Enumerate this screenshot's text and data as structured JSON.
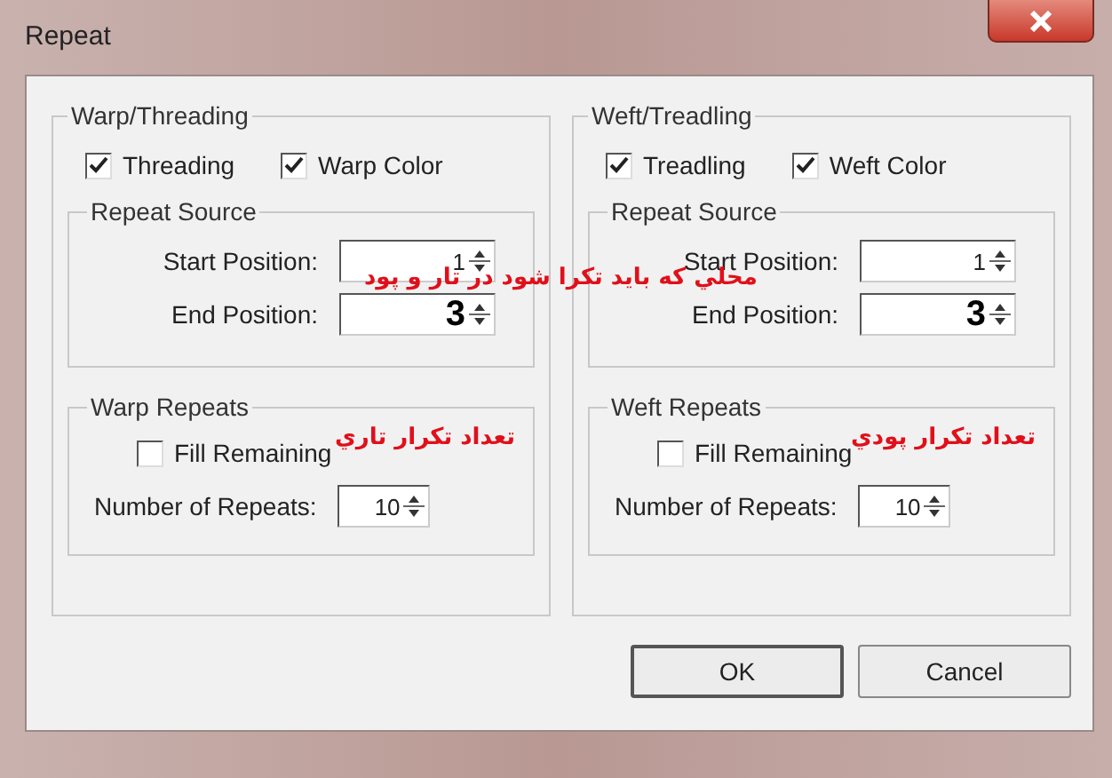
{
  "window": {
    "title": "Repeat"
  },
  "groups": [
    {
      "title": "Warp/Threading",
      "checkboxes": [
        {
          "label": "Threading",
          "checked": true
        },
        {
          "label": "Warp Color",
          "checked": true
        }
      ],
      "source": {
        "title": "Repeat Source",
        "fields": [
          {
            "label": "Start Position:",
            "value": "1",
            "bold": false
          },
          {
            "label": "End Position:",
            "value": "3",
            "bold": true
          }
        ]
      },
      "repeats": {
        "title": "Warp Repeats",
        "fill": {
          "label": "Fill Remaining",
          "checked": false
        },
        "count": {
          "label": "Number of Repeats:",
          "value": "10"
        },
        "note": "تعداد تكرار تاري"
      }
    },
    {
      "title": "Weft/Treadling",
      "checkboxes": [
        {
          "label": "Treadling",
          "checked": true
        },
        {
          "label": "Weft Color",
          "checked": true
        }
      ],
      "source": {
        "title": "Repeat Source",
        "fields": [
          {
            "label": "Start Position:",
            "value": "1",
            "bold": false
          },
          {
            "label": "End Position:",
            "value": "3",
            "bold": true
          }
        ]
      },
      "repeats": {
        "title": "Weft Repeats",
        "fill": {
          "label": "Fill Remaining",
          "checked": false
        },
        "count": {
          "label": "Number of Repeats:",
          "value": "10"
        },
        "note": "تعداد تكرار پودي"
      }
    }
  ],
  "source_note": "محلي كه بايد تكرا شود در تار و پود",
  "buttons": [
    {
      "label": "OK",
      "default": true
    },
    {
      "label": "Cancel",
      "default": false
    }
  ]
}
